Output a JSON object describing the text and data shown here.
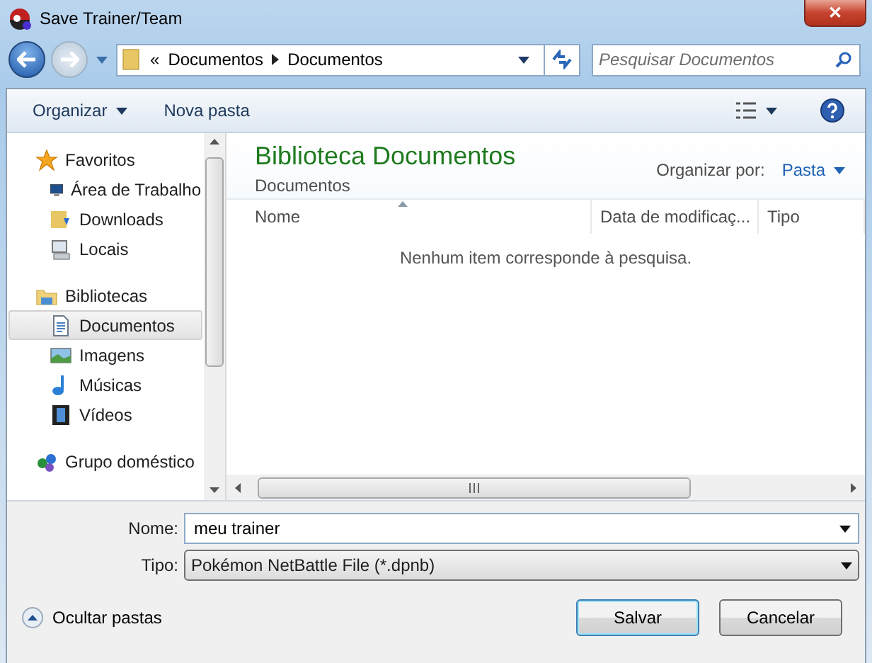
{
  "window": {
    "title": "Save Trainer/Team",
    "close": "✕"
  },
  "address": {
    "overflow": "«",
    "crumbs": [
      "Documentos",
      "Documentos"
    ],
    "search_placeholder": "Pesquisar Documentos"
  },
  "toolbar": {
    "organize": "Organizar",
    "new_folder": "Nova pasta"
  },
  "sidebar": {
    "items": [
      {
        "label": "Favoritos",
        "selected": false,
        "children": [
          {
            "label": "Área de Trabalho",
            "selected": false
          },
          {
            "label": "Downloads",
            "selected": false
          },
          {
            "label": "Locais",
            "selected": false
          }
        ]
      },
      {
        "label": "Bibliotecas",
        "selected": false,
        "children": [
          {
            "label": "Documentos",
            "selected": true
          },
          {
            "label": "Imagens",
            "selected": false
          },
          {
            "label": "Músicas",
            "selected": false
          },
          {
            "label": "Vídeos",
            "selected": false
          }
        ]
      },
      {
        "label": "Grupo doméstico",
        "selected": false
      }
    ]
  },
  "content": {
    "title": "Biblioteca Documentos",
    "subtitle": "Documentos",
    "arrange_label": "Organizar por:",
    "arrange_value": "Pasta",
    "columns": [
      "Nome",
      "Data de modificaç...",
      "Tipo"
    ],
    "empty_message": "Nenhum item corresponde à pesquisa."
  },
  "form": {
    "name_label": "Nome:",
    "name_value": "meu trainer",
    "type_label": "Tipo:",
    "type_value": "Pokémon NetBattle File (*.dpnb)"
  },
  "footer": {
    "hide_folders": "Ocultar pastas",
    "buttons": [
      {
        "label": "Salvar",
        "default": true
      },
      {
        "label": "Cancelar",
        "default": false
      }
    ]
  }
}
